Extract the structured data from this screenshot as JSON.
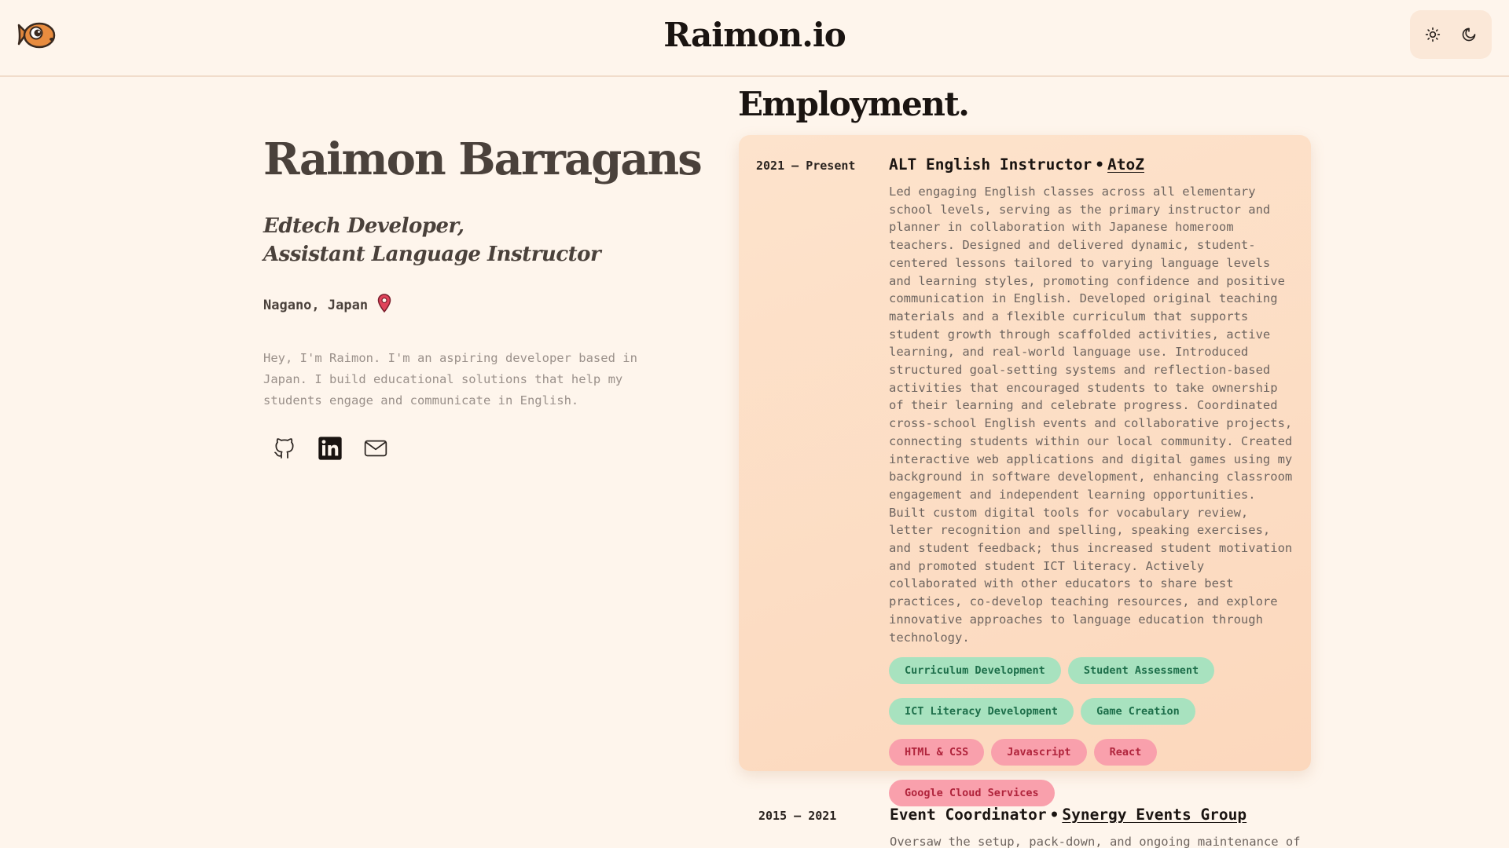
{
  "header": {
    "site_title": "Raimon.io",
    "logo_icon": "fish-logo-icon",
    "theme_light_icon": "sun-icon",
    "theme_dark_icon": "moon-icon"
  },
  "profile": {
    "name": "Raimon Barragans",
    "role_line1": "Edtech Developer,",
    "role_line2": "Assistant Language Instructor",
    "location": "Nagano, Japan",
    "bio": "Hey, I'm Raimon. I'm an aspiring developer based in Japan. I build educational solutions that help my students engage and communicate in English.",
    "socials": [
      {
        "icon": "github-icon"
      },
      {
        "icon": "linkedin-icon"
      },
      {
        "icon": "mail-icon"
      }
    ]
  },
  "employment": {
    "heading": "Employment.",
    "jobs": [
      {
        "dates": "2021 – Present",
        "title": "ALT English Instructor",
        "separator": "•",
        "company": "AtoZ",
        "description": "Led engaging English classes across all elementary school levels, serving as the primary instructor and planner in collaboration with Japanese homeroom teachers. Designed and delivered dynamic, student-centered lessons tailored to varying language levels and learning styles, promoting confidence and positive communication in English. Developed original teaching materials and a flexible curriculum that supports student growth through scaffolded activities, active learning, and real-world language use. Introduced structured goal-setting systems and reflection-based activities that encouraged students to take ownership of their learning and celebrate progress. Coordinated cross-school English events and collaborative projects, connecting students within our local community. Created interactive web applications and digital games using my background in software development, enhancing classroom engagement and independent learning opportunities. Built custom digital tools for vocabulary review, letter recognition and spelling, speaking exercises, and student feedback; thus increased student motivation and promoted student ICT literacy. Actively collaborated with other educators to share best practices, co-develop teaching resources, and explore innovative approaches to language education through technology.",
        "tags_green": [
          "Curriculum Development",
          "Student Assessment",
          "ICT Literacy Development",
          "Game Creation"
        ],
        "tags_pink": [
          "HTML & CSS",
          "Javascript",
          "React",
          "Google Cloud Services"
        ]
      },
      {
        "dates": "2015 – 2021",
        "title": "Event Coordinator",
        "separator": "•",
        "company": "Synergy Events Group",
        "description": "Oversaw the setup, pack-down, and ongoing maintenance of"
      }
    ]
  },
  "colors": {
    "background": "#fef5ec",
    "card": "#fcd8bd",
    "tag_green_bg": "#a8e2bf",
    "tag_green_text": "#1d6e4a",
    "tag_pink_bg": "#f9a0ac",
    "tag_pink_text": "#b0243c",
    "location_pin": "#e0435a"
  }
}
